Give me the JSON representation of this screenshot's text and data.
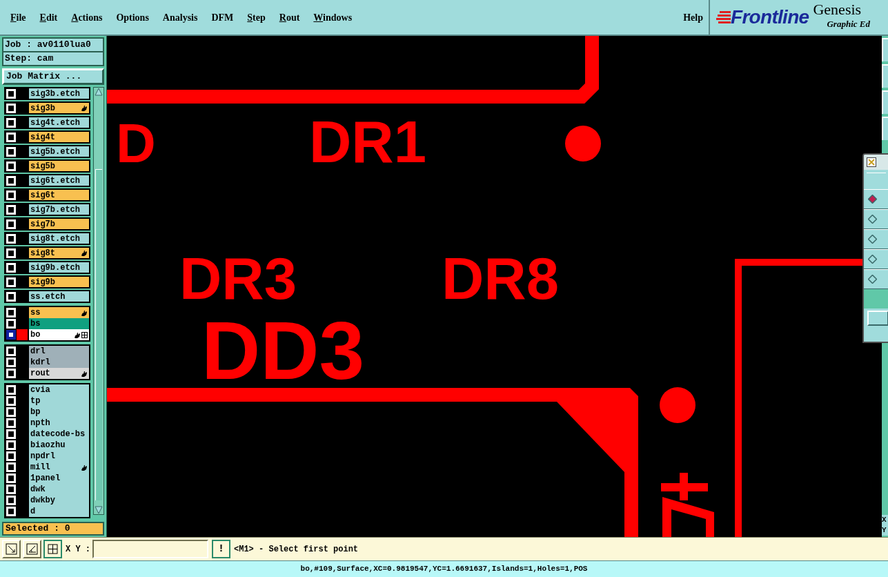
{
  "menu": [
    {
      "label": "File",
      "underline_first": true
    },
    {
      "label": "Edit",
      "underline_first": true
    },
    {
      "label": "Actions",
      "underline_first": true
    },
    {
      "label": "Options",
      "underline_first": false
    },
    {
      "label": "Analysis",
      "underline_first": false
    },
    {
      "label": "DFM",
      "underline_first": false
    },
    {
      "label": "Step",
      "underline_first": true
    },
    {
      "label": "Rout",
      "underline_first": true
    },
    {
      "label": "Windows",
      "underline_first": true
    }
  ],
  "help": "Help",
  "brand": {
    "logo": "Frontline",
    "title": "Genesis",
    "subtitle": "Graphic Ed"
  },
  "job": "Job : av0110lua0",
  "step": "Step: cam",
  "job_matrix": "Job Matrix ...",
  "layer_groups": [
    [
      {
        "name": "sig3b.etch",
        "color": "#a0d8d8",
        "hand": false,
        "selected": false
      },
      {
        "name": "sig3b",
        "color": "#f8c050",
        "hand": true,
        "selected": false
      },
      {
        "name": "sig4t.etch",
        "color": "#a0d8d8",
        "hand": false,
        "selected": false
      },
      {
        "name": "sig4t",
        "color": "#f8c050",
        "hand": false,
        "selected": false
      },
      {
        "name": "sig5b.etch",
        "color": "#a0d8d8",
        "hand": false,
        "selected": false
      },
      {
        "name": "sig5b",
        "color": "#f8c050",
        "hand": false,
        "selected": false
      },
      {
        "name": "sig6t.etch",
        "color": "#a0d8d8",
        "hand": false,
        "selected": false
      },
      {
        "name": "sig6t",
        "color": "#f8c050",
        "hand": false,
        "selected": false
      },
      {
        "name": "sig7b.etch",
        "color": "#a0d8d8",
        "hand": false,
        "selected": false
      },
      {
        "name": "sig7b",
        "color": "#f8c050",
        "hand": false,
        "selected": false
      },
      {
        "name": "sig8t.etch",
        "color": "#a0d8d8",
        "hand": false,
        "selected": false
      },
      {
        "name": "sig8t",
        "color": "#f8c050",
        "hand": true,
        "selected": false
      },
      {
        "name": "sig9b.etch",
        "color": "#a0d8d8",
        "hand": false,
        "selected": false
      },
      {
        "name": "sig9b",
        "color": "#f8c050",
        "hand": false,
        "selected": false
      },
      {
        "name": "ss.etch",
        "color": "#a0d8d8",
        "hand": false,
        "selected": false
      }
    ],
    [
      {
        "name": "ss",
        "color": "#f8c050",
        "hand": true,
        "selected": false
      },
      {
        "name": "bs",
        "color": "#10a080",
        "hand": false,
        "selected": false
      },
      {
        "name": "bo",
        "color": "#ffffff",
        "hand": true,
        "selected": true
      }
    ],
    [
      {
        "name": "drl",
        "color": "#9fb0b8",
        "hand": false,
        "selected": false
      },
      {
        "name": "kdrl",
        "color": "#9fb0b8",
        "hand": false,
        "selected": false
      },
      {
        "name": "rout",
        "color": "#d8d8d8",
        "hand": true,
        "selected": false
      }
    ],
    [
      {
        "name": "cvia",
        "color": "#a0d8d8",
        "hand": false,
        "selected": false
      },
      {
        "name": "tp",
        "color": "#a0d8d8",
        "hand": false,
        "selected": false
      },
      {
        "name": "bp",
        "color": "#a0d8d8",
        "hand": false,
        "selected": false
      },
      {
        "name": "npth",
        "color": "#a0d8d8",
        "hand": false,
        "selected": false
      },
      {
        "name": "datecode-bs",
        "color": "#a0d8d8",
        "hand": false,
        "selected": false
      },
      {
        "name": "biaozhu",
        "color": "#a0d8d8",
        "hand": false,
        "selected": false
      },
      {
        "name": "npdrl",
        "color": "#a0d8d8",
        "hand": false,
        "selected": false
      },
      {
        "name": "mill",
        "color": "#a0d8d8",
        "hand": true,
        "selected": false
      },
      {
        "name": "1panel",
        "color": "#a0d8d8",
        "hand": false,
        "selected": false
      },
      {
        "name": "dwk",
        "color": "#a0d8d8",
        "hand": false,
        "selected": false
      },
      {
        "name": "dwkby",
        "color": "#a0d8d8",
        "hand": false,
        "selected": false
      },
      {
        "name": "d",
        "color": "#a0d8d8",
        "hand": false,
        "selected": false
      }
    ]
  ],
  "selected_count": "Selected : 0",
  "silkscreen": [
    {
      "text": "D"
    },
    {
      "text": "DR1"
    },
    {
      "text": "DR3"
    },
    {
      "text": "DR8"
    },
    {
      "text": "DD3"
    }
  ],
  "popup": {
    "options": [
      {
        "selected": true
      },
      {
        "selected": false
      },
      {
        "selected": false
      },
      {
        "selected": false
      },
      {
        "selected": false
      }
    ]
  },
  "coords": {
    "x": "X",
    "y": "Y"
  },
  "xy_label": "X Y :",
  "alert": "!",
  "prompt": "<M1> - Select first point",
  "status": "bo,#109,Surface,XC=0.9819547,YC=1.6691637,Islands=1,Holes=1,POS"
}
